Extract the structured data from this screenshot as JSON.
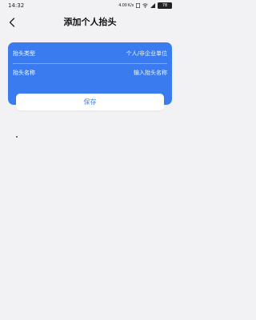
{
  "status_bar": {
    "time": "14:32",
    "network": "4.00 K/s",
    "battery": "78"
  },
  "header": {
    "title": "添加个人抬头"
  },
  "form": {
    "rows": [
      {
        "label": "抬头类型",
        "value": "个人/非企业单位"
      },
      {
        "label": "抬头名称",
        "placeholder": "输入抬头名称"
      }
    ]
  },
  "actions": {
    "save_label": "保存"
  },
  "colors": {
    "accent": "#3a7cf0",
    "background": "#f2f2f4"
  }
}
